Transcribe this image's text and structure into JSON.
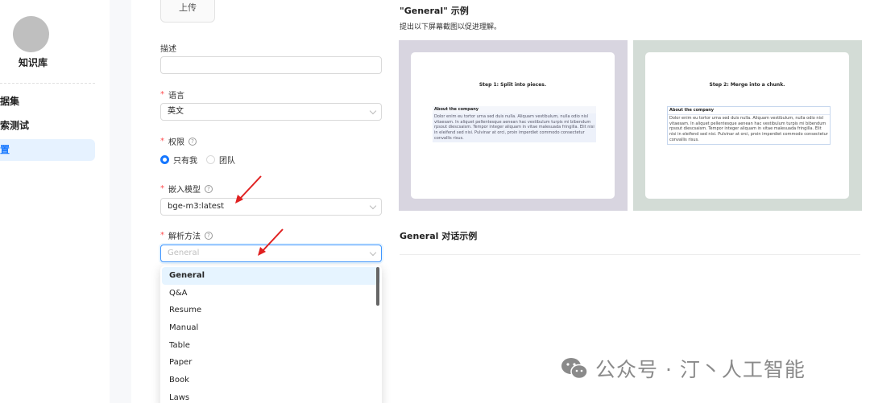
{
  "sidebar": {
    "kb_name": "知识库",
    "items": [
      {
        "label": "数据集"
      },
      {
        "label": "检索测试"
      },
      {
        "label": "配置",
        "active": true
      }
    ]
  },
  "form": {
    "upload_label": "上传",
    "description": {
      "label": "描述",
      "value": ""
    },
    "language": {
      "label": "语言",
      "value": "英文"
    },
    "permission": {
      "label": "权限",
      "options": [
        "只有我",
        "团队"
      ],
      "selected": "只有我"
    },
    "embedding_model": {
      "label": "嵌入模型",
      "value": "bge-m3:latest"
    },
    "parse_method": {
      "label": "解析方法",
      "placeholder": "General",
      "options": [
        "General",
        "Q&A",
        "Resume",
        "Manual",
        "Table",
        "Paper",
        "Book",
        "Laws"
      ],
      "highlighted": "General"
    }
  },
  "example": {
    "title": "\"General\" 示例",
    "subtitle": "提出以下屏幕截图以促进理解。",
    "screens": [
      {
        "step": "Step 1: Split into pieces.",
        "heading": "About the company",
        "body": "Dolor enim eu tortor urna sed duis nulla. Aliquam vestibulum, nulla odio nisl vitaesam. In aliquet pellentesque aenean hac vestibulum turpis mi bibendum rpsout diescsaism. Tempor integer aliquam in vitae malesuada fringilla. Elit nisi in eleifend sed nisi. Pulvinar at orci, proin imperdiet commodo consectetur convallis risus."
      },
      {
        "step": "Step 2: Merge into a chunk.",
        "heading": "About the company",
        "body": "Dolor enim eu tortor urna sed duis nulla. Aliquam vestibulum, nulla odio nisl vitaesam. In aliquet pellentesque aenean hac vestibulum turpis mi bibendum rpsout diescsaism. Tempor integer aliquam in vitae malesuada fringilla. Elit nisi in eleifend sed nisi. Pulvinar at orci, proin imperdiet commodo consectetur convallis risus."
      }
    ],
    "chat_title": "General 对话示例"
  },
  "watermark": "公众号 · 汀丶人工智能",
  "colors": {
    "accent": "#1677ff",
    "required": "#ff4d4f",
    "annotation_arrow": "#e02020"
  }
}
